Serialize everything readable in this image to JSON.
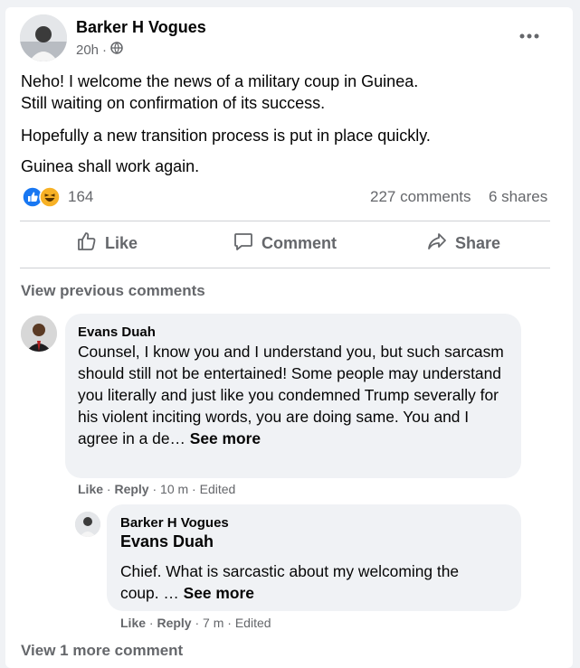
{
  "post": {
    "author": "Barker H Vogues",
    "time": "20h",
    "separator": "·",
    "lines": [
      "Neho! I welcome the news of a military coup in Guinea.",
      "Still waiting on confirmation of its success.",
      "Hopefully a new transition process is put in place quickly.",
      "Guinea shall work again."
    ],
    "reaction_count": "164",
    "comments_count": "227 comments",
    "shares_count": "6 shares"
  },
  "actions": {
    "like": "Like",
    "comment": "Comment",
    "share": "Share"
  },
  "view_previous": "View previous comments",
  "comment1": {
    "author": "Evans Duah",
    "text": "Counsel, I know you and I understand you, but such sarcasm should still not be entertained! Some people may understand you literally and just like you condemned Trump severally for his violent inciting words, you are doing same. You and I agree in a de…",
    "see_more": "See more",
    "like": "Like",
    "reply": "Reply",
    "time": "10 m",
    "edited": "Edited"
  },
  "reply1": {
    "author": "Barker H Vogues",
    "tag": "Evans Duah",
    "text": "Chief. What is sarcastic about my welcoming the coup. …",
    "see_more": "See more",
    "like": "Like",
    "reply": "Reply",
    "time": "7 m",
    "edited": "Edited"
  },
  "view_more": "View 1 more comment",
  "colors": {
    "like_blue": "#1877f2",
    "haha_yellow": "#f7b125",
    "text": "#050505",
    "secondary": "#65676b",
    "bubble": "#f0f2f5"
  },
  "icons": [
    "globe-icon",
    "more-options-icon",
    "like-reaction-icon",
    "haha-reaction-icon",
    "thumbs-up-icon",
    "comment-icon",
    "share-icon"
  ]
}
